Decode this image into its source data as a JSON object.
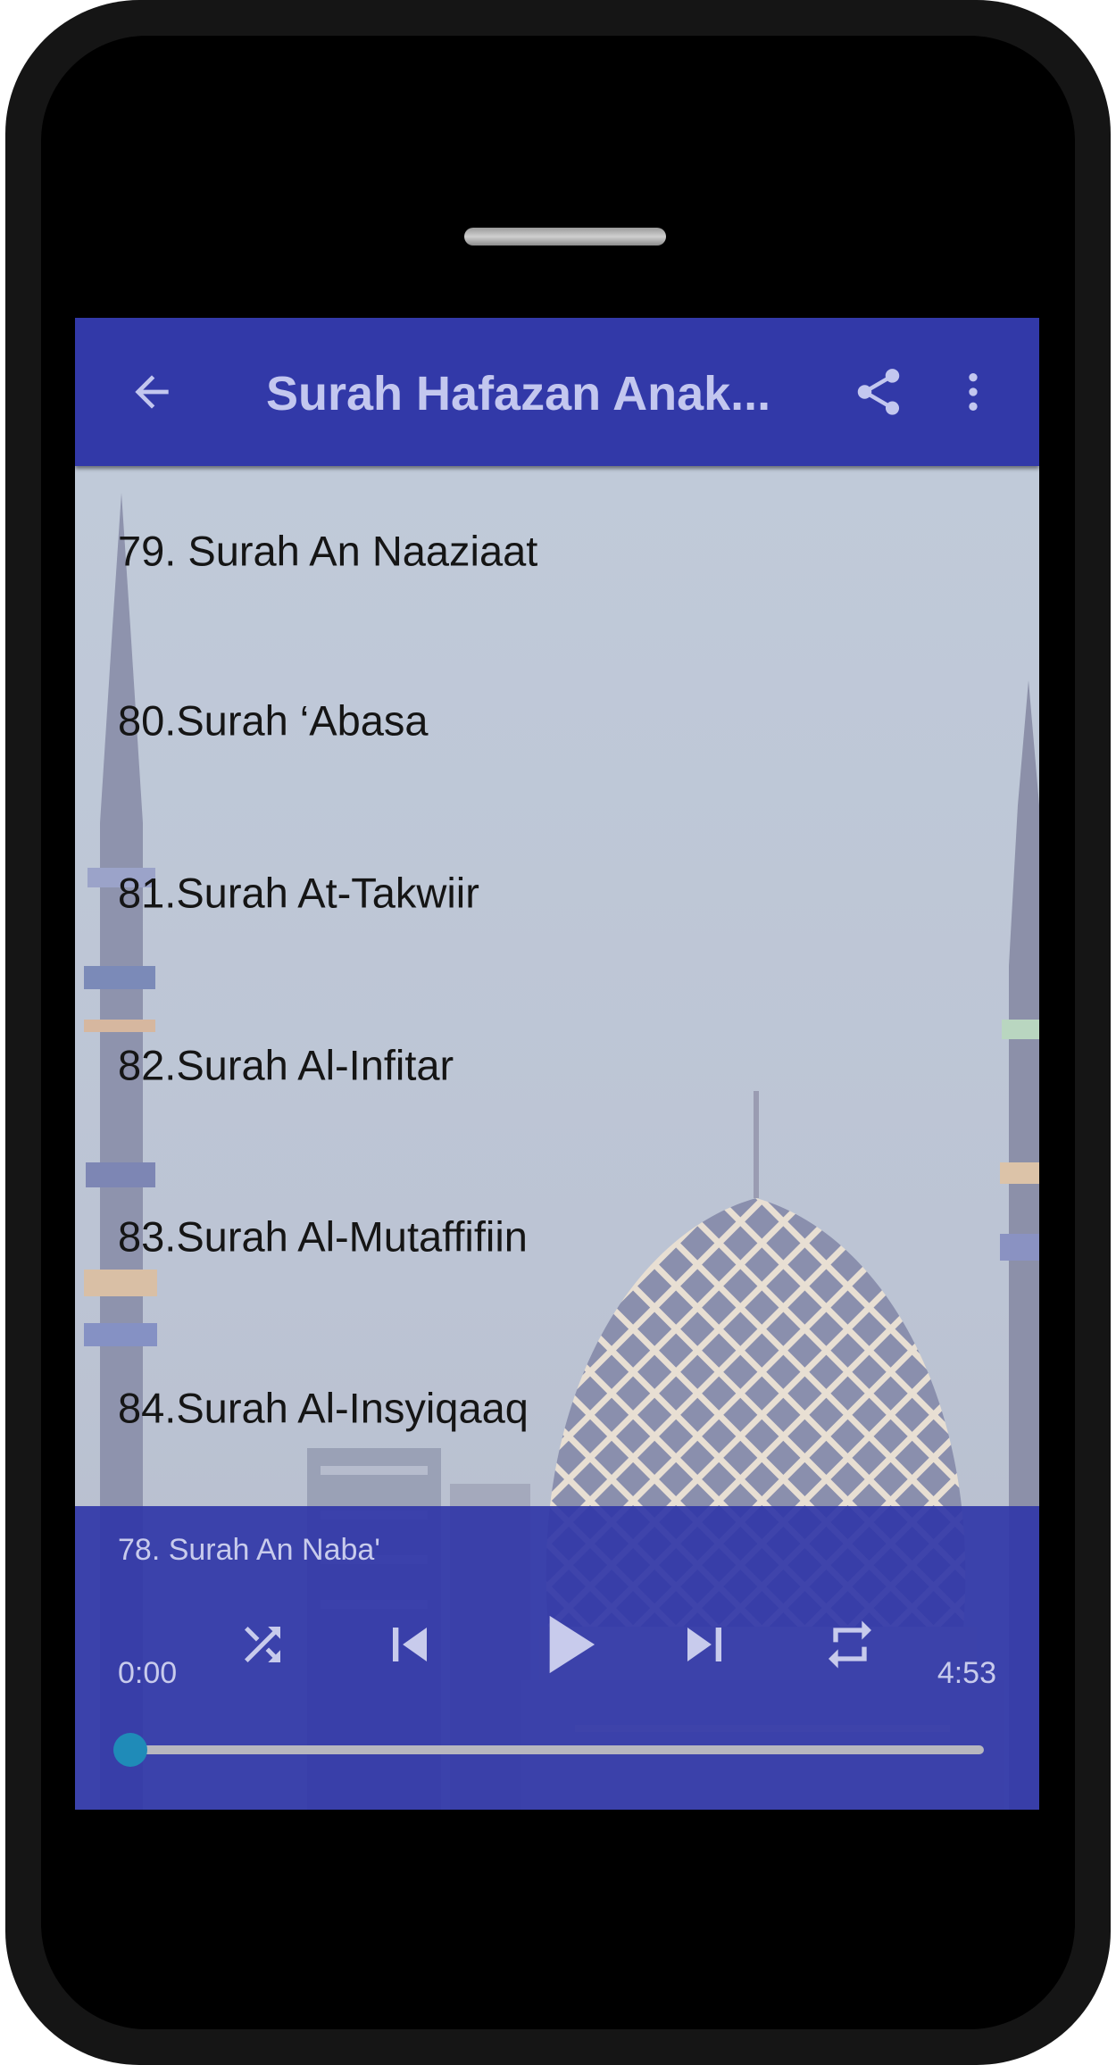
{
  "app": {
    "title": "Surah Hafazan Anak..."
  },
  "toolbar": {
    "back_icon": "arrow-back-icon",
    "share_icon": "share-icon",
    "menu_icon": "more-vert-icon"
  },
  "surah_list": [
    {
      "label": "79. Surah An Naaziaat"
    },
    {
      "label": "80.Surah ‘Abasa"
    },
    {
      "label": "81.Surah At-Takwiir"
    },
    {
      "label": "82.Surah Al-Infitar"
    },
    {
      "label": "83.Surah Al-Mutaffifiin"
    },
    {
      "label": "84.Surah Al-Insyiqaaq"
    }
  ],
  "player": {
    "now_playing": "78. Surah An Naba'",
    "current_time": "0:00",
    "total_time": "4:53",
    "progress": 0.0,
    "controls": [
      "shuffle-icon",
      "skip-previous-icon",
      "play-icon",
      "skip-next-icon",
      "repeat-icon"
    ]
  },
  "colors": {
    "appbar": "#3239a8",
    "title_text": "#c3c7ef",
    "player_bg": "#3238a8",
    "seek_thumb": "#1f8bb8"
  }
}
